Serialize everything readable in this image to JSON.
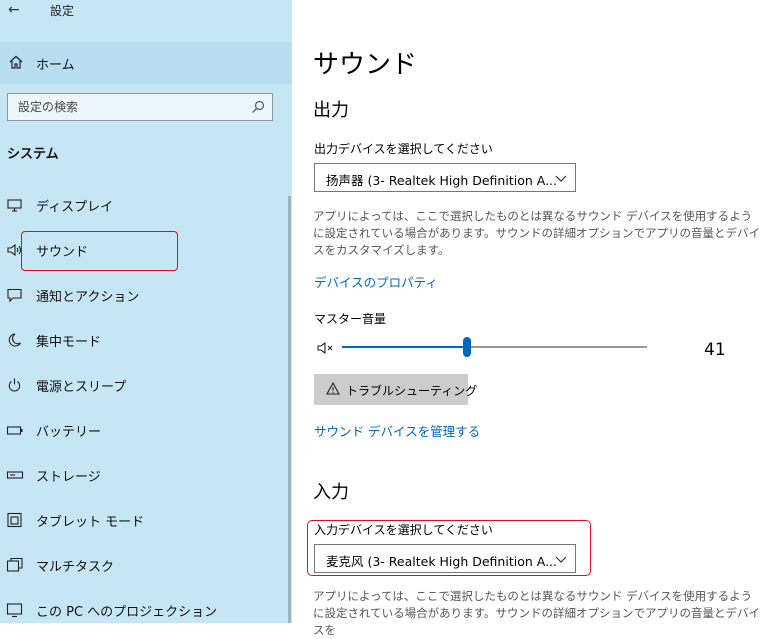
{
  "window": {
    "title": "設定"
  },
  "sidebar": {
    "home_label": "ホーム",
    "search_placeholder": "設定の検索",
    "section_header": "システム",
    "items": [
      {
        "label": "ディスプレイ",
        "icon": "monitor-icon"
      },
      {
        "label": "サウンド",
        "icon": "speaker-icon"
      },
      {
        "label": "通知とアクション",
        "icon": "notification-icon"
      },
      {
        "label": "集中モード",
        "icon": "moon-icon"
      },
      {
        "label": "電源とスリープ",
        "icon": "power-icon"
      },
      {
        "label": "バッテリー",
        "icon": "battery-icon"
      },
      {
        "label": "ストレージ",
        "icon": "storage-icon"
      },
      {
        "label": "タブレット モード",
        "icon": "tablet-icon"
      },
      {
        "label": "マルチタスク",
        "icon": "multitask-icon"
      },
      {
        "label": "この PC へのプロジェクション",
        "icon": "projection-icon"
      }
    ],
    "selected_index": 1
  },
  "main": {
    "page_title": "サウンド",
    "output": {
      "heading": "出力",
      "select_label": "出力デバイスを選択してください",
      "selected_device": "扬声器 (3- Realtek High Definition A...",
      "description": "アプリによっては、ここで選択したものとは異なるサウンド デバイスを使用するように設定されている場合があります。サウンドの詳細オプションでアプリの音量とデバイスをカスタマイズします。",
      "properties_link": "デバイスのプロパティ",
      "master_volume_label": "マスター音量",
      "volume_value": 41,
      "troubleshoot_label": "トラブルシューティング",
      "manage_link": "サウンド デバイスを管理する"
    },
    "input": {
      "heading": "入力",
      "select_label": "入力デバイスを選択してください",
      "selected_device": "麦克风 (3- Realtek High Definition A...",
      "description": "アプリによっては、ここで選択したものとは異なるサウンド デバイスを使用するように設定されている場合があります。サウンドの詳細オプションでアプリの音量とデバイスを"
    }
  },
  "colors": {
    "sidebar_bg": "#c7e6f5",
    "accent": "#0067c0",
    "highlight": "#e0101a"
  }
}
